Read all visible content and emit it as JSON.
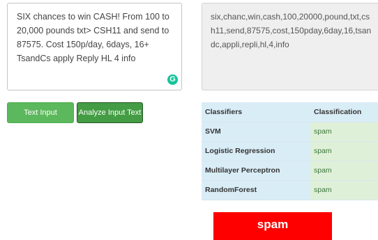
{
  "input": {
    "text": "SIX chances to win CASH! From 100 to 20,000 pounds txt> CSH11 and send to 87575. Cost 150p/day, 6days, 16+ TsandCs apply Reply HL 4 info",
    "grammarly_glyph": "G"
  },
  "output": {
    "cleaned_text": "six,chanc,win,cash,100,20000,pound,txt,csh11,send,87575,cost,150pday,6day,16,tsandc,appli,repli,hl,4,info"
  },
  "buttons": {
    "clean_label": "Text Input Cleaning",
    "analyze_label": "Analyze Input Text"
  },
  "results": {
    "headers": [
      "Classifiers",
      "Classification"
    ],
    "rows": [
      {
        "classifier": "SVM",
        "classification": "spam"
      },
      {
        "classifier": "Logistic Regression",
        "classification": "spam"
      },
      {
        "classifier": "Multilayer Perceptron",
        "classification": "spam"
      },
      {
        "classifier": "RandomForest",
        "classification": "spam"
      }
    ]
  },
  "verdict": {
    "label": "spam",
    "color": "#ff0000"
  },
  "colors": {
    "button_green": "#5cb85c",
    "button_green_dark": "#449d44",
    "header_blue": "#d9edf7",
    "result_green": "#dff0d8",
    "grammarly": "#15c39a"
  }
}
